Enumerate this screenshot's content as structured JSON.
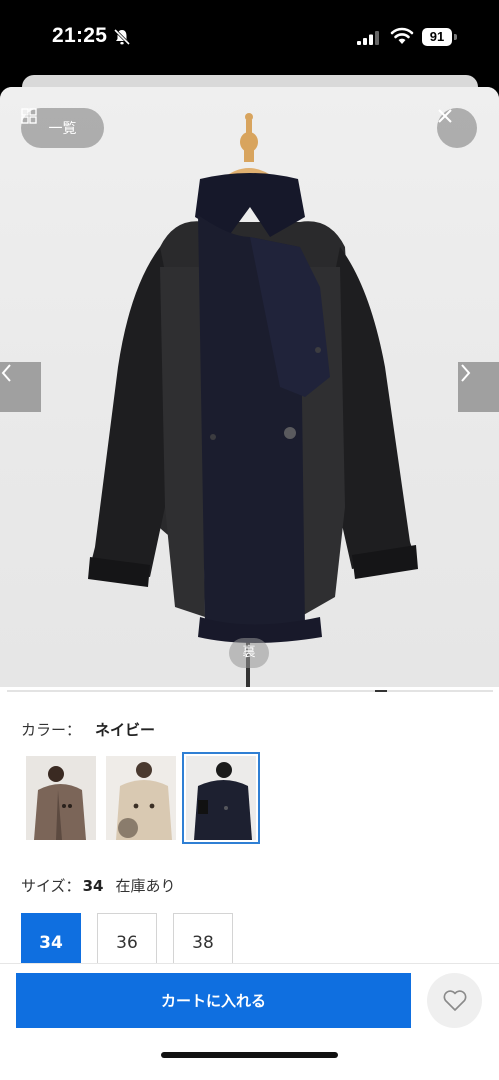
{
  "status_bar": {
    "time": "21:25",
    "battery": "91",
    "bell_icon": "bell-slash-icon"
  },
  "gallery": {
    "list_button_label": "一覧",
    "list_icon": "grid-icon",
    "close_icon": "close-icon",
    "prev_icon": "chevron-left-icon",
    "next_icon": "chevron-right-icon",
    "back_view_label": "裏"
  },
  "color": {
    "label": "カラー：",
    "value": "ネイビー",
    "selected_index": 2,
    "accent": "#2f7fd4"
  },
  "size": {
    "label": "サイズ：",
    "value": "34",
    "stock": "在庫あり",
    "options": [
      "34",
      "36",
      "38"
    ]
  },
  "actions": {
    "cart_label": "カートに入れる",
    "favorite_icon": "heart-icon",
    "accent": "#0f6fe0"
  }
}
